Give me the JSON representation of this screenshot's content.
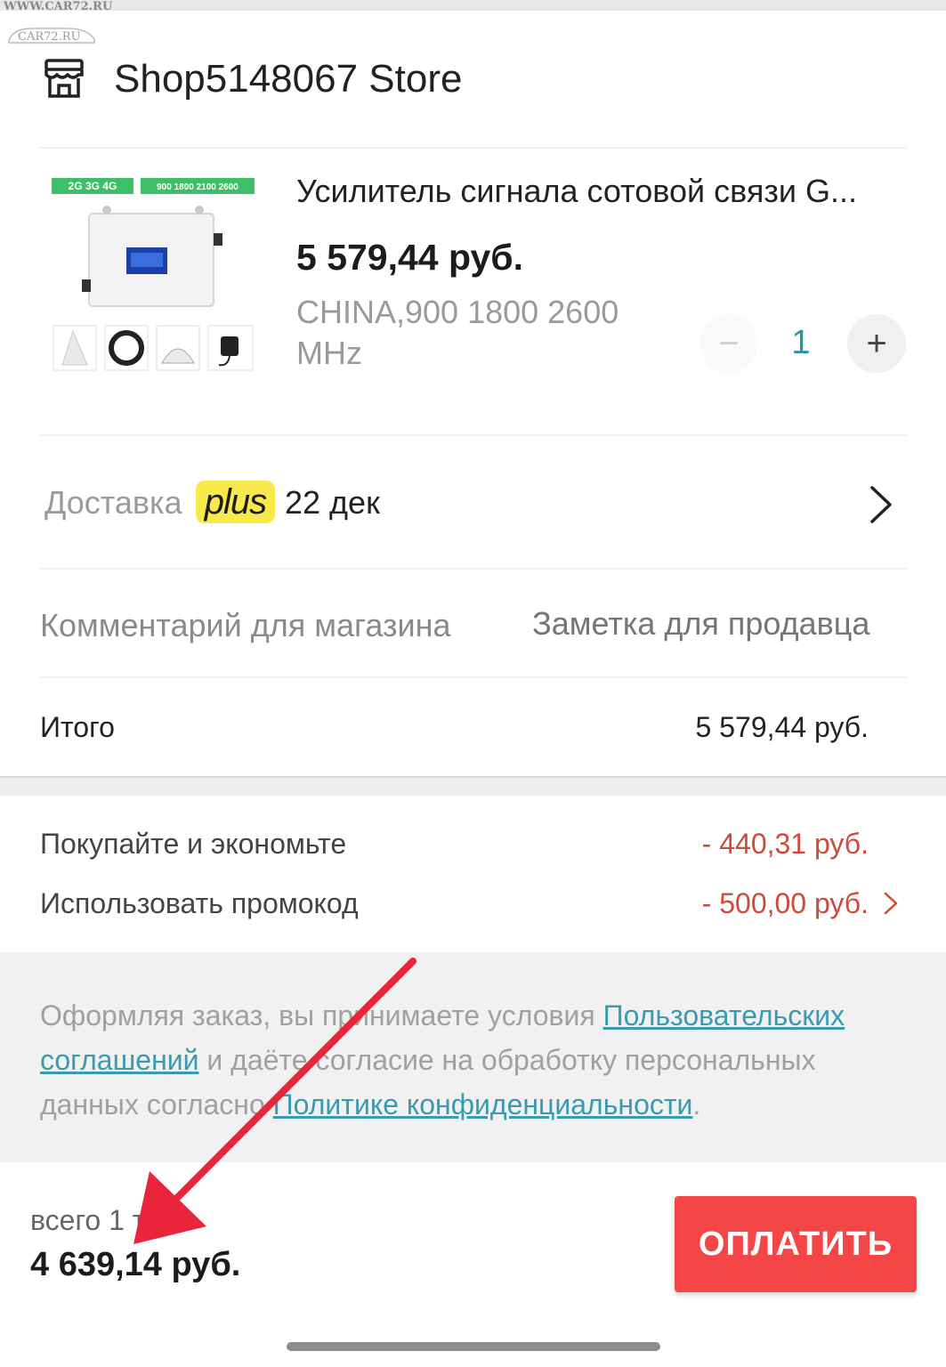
{
  "watermark": {
    "line1": "WWW.CAR72.RU",
    "line2": "CAR72.RU"
  },
  "store": {
    "name": "Shop5148067 Store",
    "icon": "store-icon"
  },
  "product": {
    "badge_left": "2G 3G 4G",
    "badge_right": "900 1800 2100 2600",
    "title": "Усилитель сигнала сотовой связи G...",
    "price": "5 579,44 руб.",
    "variant": "CHINA,900 1800 2600 MHz",
    "quantity": "1",
    "minus": "−",
    "plus": "+"
  },
  "delivery": {
    "label": "Доставка",
    "badge": "plus",
    "date": "22 дек",
    "icon": "chevron-right-icon"
  },
  "comment": {
    "label": "Комментарий для магазина",
    "placeholder": "Заметка для продавца"
  },
  "subtotal": {
    "label": "Итого",
    "value": "5 579,44 руб."
  },
  "discounts": {
    "save_label": "Покупайте и экономьте",
    "save_value": "- 440,31 руб.",
    "promo_label": "Использовать промокод",
    "promo_value": "- 500,00 руб."
  },
  "terms": {
    "part1": "Оформляя заказ, вы принимаете условия ",
    "link1": "Пользовательских соглашений",
    "part2": " и даёте согласие на обработку персональных данных согласно ",
    "link2": "Политике конфиденциальности",
    "part3": "."
  },
  "checkout": {
    "items_count": "всего 1 тов.",
    "total": "4 639,14 руб.",
    "pay_label": "ОПЛАТИТЬ"
  },
  "colors": {
    "accent": "#f44646",
    "discount": "#cf4a3a",
    "link": "#3a9bb0",
    "plus_badge": "#f7e94a",
    "arrow": "#e8253a"
  }
}
